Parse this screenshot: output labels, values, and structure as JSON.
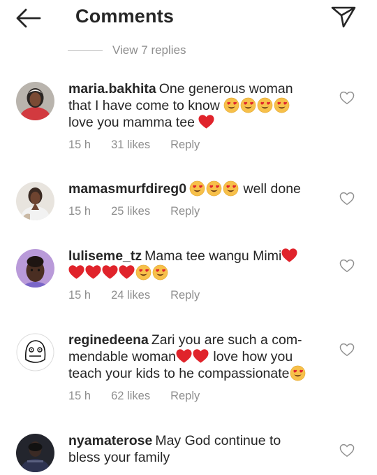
{
  "header": {
    "title": "Comments",
    "back_icon": "arrow-left-icon",
    "send_icon": "paper-plane-icon"
  },
  "view_replies": "View 7 replies",
  "comments": [
    {
      "username": "maria.bakhita",
      "text1": "One generous woman",
      "text2": "that I have come to know",
      "text3": "love you mamma tee",
      "time": "15 h",
      "likes": "31 likes",
      "reply": "Reply"
    },
    {
      "username": "mamasmurfdireg0",
      "text1": "well done",
      "time": "15 h",
      "likes": "25 likes",
      "reply": "Reply"
    },
    {
      "username": "luliseme_tz",
      "text1": "Mama tee wangu Mimi",
      "time": "15 h",
      "likes": "24 likes",
      "reply": "Reply"
    },
    {
      "username": "reginedeena",
      "text1": "Zari you are such a com-",
      "text2": "mendable woman",
      "text2b": "love how you",
      "text3": "teach your kids to he compassionate",
      "time": "15 h",
      "likes": "62 likes",
      "reply": "Reply"
    },
    {
      "username": "nyamaterose",
      "text1": "May God continue to",
      "text2": "bless your family"
    }
  ],
  "colors": {
    "text": "#262626",
    "muted": "#8e8e8e",
    "heart": "#e0232b",
    "emoji": "#f7c04a"
  }
}
